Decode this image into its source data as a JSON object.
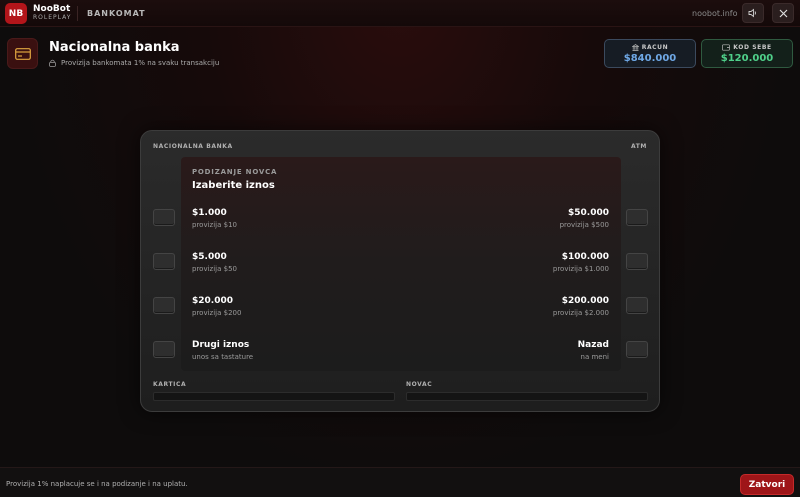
{
  "topbar": {
    "logo": "NB",
    "brand_name": "NooBot",
    "brand_sub": "ROLEPLAY",
    "section": "BANKOMAT",
    "site": "noobot.info",
    "sound_icon": "speaker-icon",
    "close_icon": "close-icon"
  },
  "header": {
    "icon": "credit-card-icon",
    "title": "Nacionalna banka",
    "subtitle": "Provizija bankomata 1% na svaku transakciju",
    "subtitle_icon": "lock-icon"
  },
  "balances": {
    "account": {
      "label": "RACUN",
      "value": "$840.000",
      "icon": "bank-icon"
    },
    "cash": {
      "label": "KOD SEBE",
      "value": "$120.000",
      "icon": "wallet-icon"
    }
  },
  "atm": {
    "label_left": "NACIONALNA BANKA",
    "label_right": "ATM",
    "screen": {
      "kicker": "PODIZANJE NOVCA",
      "title": "Izaberite iznos",
      "left_options": [
        {
          "main": "$1.000",
          "fee": "provizija $10"
        },
        {
          "main": "$5.000",
          "fee": "provizija $50"
        },
        {
          "main": "$20.000",
          "fee": "provizija $200"
        },
        {
          "main": "Drugi iznos",
          "fee": "unos sa tastature"
        }
      ],
      "right_options": [
        {
          "main": "$50.000",
          "fee": "provizija $500"
        },
        {
          "main": "$100.000",
          "fee": "provizija $1.000"
        },
        {
          "main": "$200.000",
          "fee": "provizija $2.000"
        },
        {
          "main": "Nazad",
          "fee": "na meni"
        }
      ]
    },
    "card_slot_label": "KARTICA",
    "cash_slot_label": "NOVAC"
  },
  "footer": {
    "note": "Provizija 1% naplacuje se i na podizanje i na uplatu.",
    "close_label": "Zatvori"
  },
  "colors": {
    "accent_red": "#b3151a",
    "account_blue": "#6fa8e6",
    "cash_green": "#4fd08a"
  }
}
